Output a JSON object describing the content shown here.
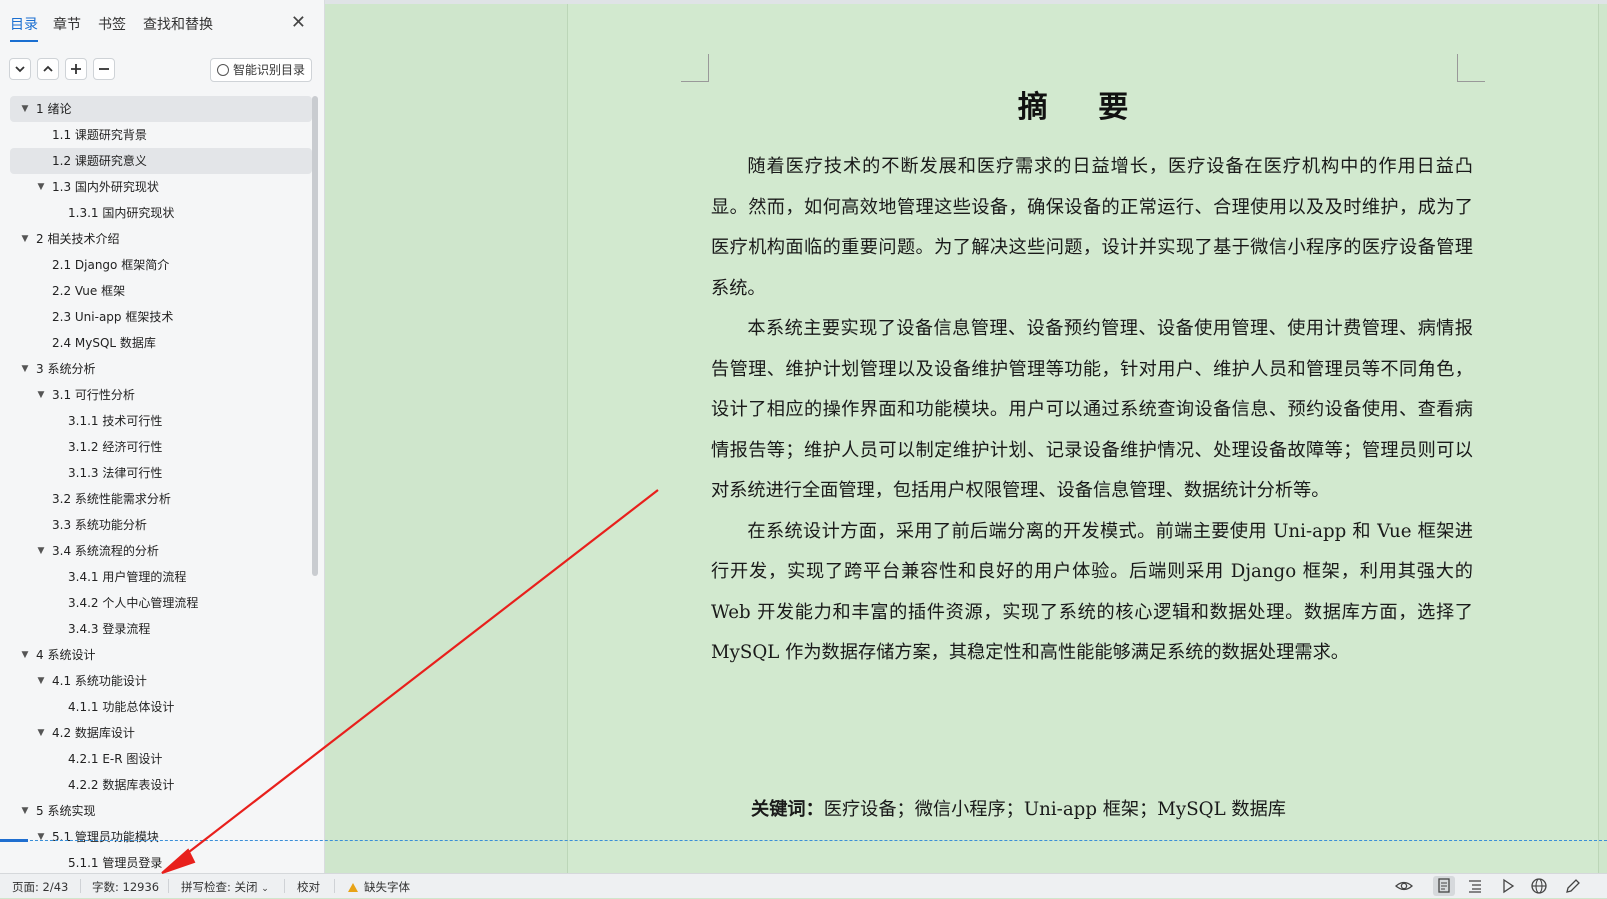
{
  "sidebar": {
    "tabs": [
      "目录",
      "章节",
      "书签",
      "查找和替换"
    ],
    "active_tab": "目录",
    "toolbar": {
      "expand_icon": "chevron-down-icon",
      "collapse_icon": "chevron-up-icon",
      "add_icon": "plus-icon",
      "remove_icon": "minus-icon",
      "smart_label": "智能识别目录"
    },
    "toc": [
      {
        "label": "1  绪论",
        "level": 1,
        "expanded": true,
        "selected": true
      },
      {
        "label": "1.1  课题研究背景",
        "level": 2
      },
      {
        "label": "1.2  课题研究意义",
        "level": 2,
        "selected": true
      },
      {
        "label": "1.3  国内外研究现状",
        "level": 2,
        "expanded": true
      },
      {
        "label": "1.3.1 国内研究现状",
        "level": 3
      },
      {
        "label": "2  相关技术介绍",
        "level": 1,
        "expanded": true
      },
      {
        "label": "2.1 Django 框架简介",
        "level": 2
      },
      {
        "label": "2.2 Vue 框架",
        "level": 2
      },
      {
        "label": "2.3 Uni-app 框架技术",
        "level": 2
      },
      {
        "label": "2.4 MySQL 数据库",
        "level": 2
      },
      {
        "label": "3  系统分析",
        "level": 1,
        "expanded": true
      },
      {
        "label": "3.1 可行性分析",
        "level": 2,
        "expanded": true
      },
      {
        "label": "3.1.1 技术可行性",
        "level": 3
      },
      {
        "label": "3.1.2 经济可行性",
        "level": 3
      },
      {
        "label": "3.1.3 法律可行性",
        "level": 3
      },
      {
        "label": "3.2 系统性能需求分析",
        "level": 2
      },
      {
        "label": "3.3 系统功能分析",
        "level": 2
      },
      {
        "label": "3.4 系统流程的分析",
        "level": 2,
        "expanded": true
      },
      {
        "label": "3.4.1 用户管理的流程",
        "level": 3
      },
      {
        "label": "3.4.2 个人中心管理流程",
        "level": 3
      },
      {
        "label": "3.4.3 登录流程",
        "level": 3
      },
      {
        "label": "4  系统设计",
        "level": 1,
        "expanded": true
      },
      {
        "label": "4.1  系统功能设计",
        "level": 2,
        "expanded": true
      },
      {
        "label": "4.1.1 功能总体设计",
        "level": 3
      },
      {
        "label": "4.2  数据库设计",
        "level": 2,
        "expanded": true
      },
      {
        "label": "4.2.1 E-R 图设计",
        "level": 3
      },
      {
        "label": "4.2.2  数据库表设计",
        "level": 3
      },
      {
        "label": "5  系统实现",
        "level": 1,
        "expanded": true
      },
      {
        "label": "5.1  管理员功能模块",
        "level": 2,
        "expanded": true
      },
      {
        "label": "5.1.1 管理员登录",
        "level": 3
      }
    ]
  },
  "document": {
    "title": "摘    要",
    "paragraphs": [
      "随着医疗技术的不断发展和医疗需求的日益增长，医疗设备在医疗机构中的作用日益凸显。然而，如何高效地管理这些设备，确保设备的正常运行、合理使用以及及时维护，成为了医疗机构面临的重要问题。为了解决这些问题，设计并实现了基于微信小程序的医疗设备管理系统。",
      "本系统主要实现了设备信息管理、设备预约管理、设备使用管理、使用计费管理、病情报告管理、维护计划管理以及设备维护管理等功能，针对用户、维护人员和管理员等不同角色，设计了相应的操作界面和功能模块。用户可以通过系统查询设备信息、预约设备使用、查看病情报告等；维护人员可以制定维护计划、记录设备维护情况、处理设备故障等；管理员则可以对系统进行全面管理，包括用户权限管理、设备信息管理、数据统计分析等。",
      "在系统设计方面，采用了前后端分离的开发模式。前端主要使用 Uni-app 和 Vue 框架进行开发，实现了跨平台兼容性和良好的用户体验。后端则采用 Django 框架，利用其强大的 Web 开发能力和丰富的插件资源，实现了系统的核心逻辑和数据处理。数据库方面，选择了 MySQL 作为数据存储方案，其稳定性和高性能能够满足系统的数据处理需求。"
    ],
    "keywords_label": "关键词：",
    "keywords": "医疗设备；微信小程序；Uni-app 框架；MySQL 数据库"
  },
  "status": {
    "page": "页面: 2/43",
    "words": "字数: 12936",
    "spellcheck": "拼写检查: 关闭",
    "proofread": "校对",
    "missing_font": "缺失字体",
    "right_icons": [
      "eye-icon",
      "page-view-icon",
      "outline-view-icon",
      "play-icon",
      "globe-icon",
      "pen-icon"
    ]
  },
  "colors": {
    "accent": "#1a6fd1",
    "page_bg": "#d2e9cf",
    "annotation_arrow": "#e8201c"
  }
}
